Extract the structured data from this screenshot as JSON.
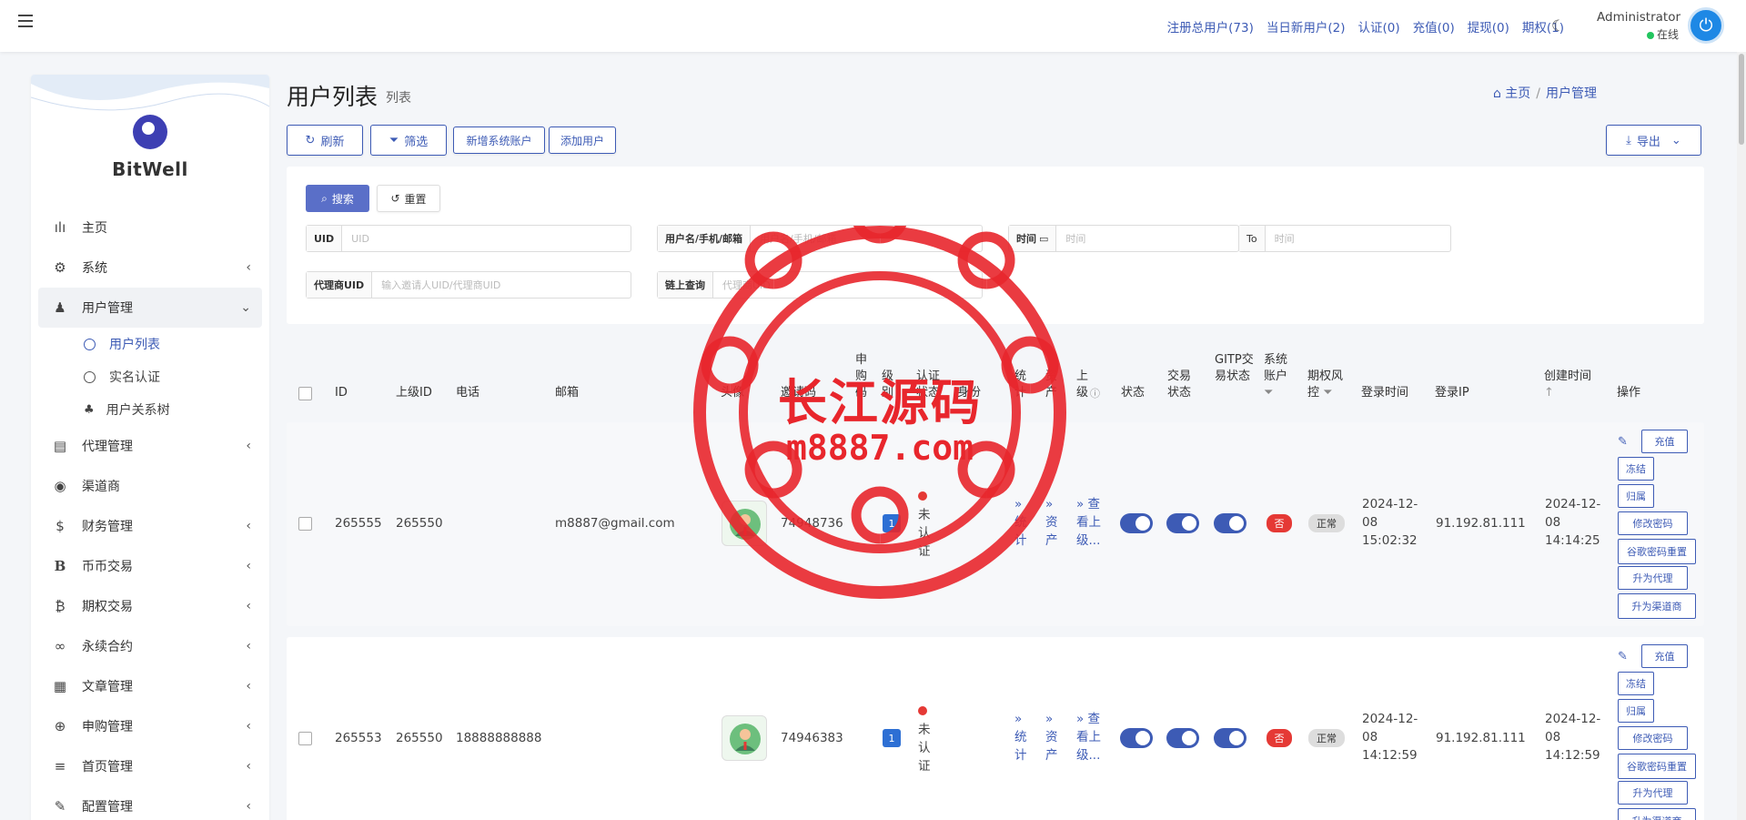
{
  "topbar": {
    "nav": [
      "注册总用户(73)",
      "当日新用户(2)",
      "认证(0)",
      "充值(0)",
      "提现(0)",
      "期权(1)"
    ],
    "admin_name": "Administrator",
    "admin_status": "在线"
  },
  "sidebar": {
    "logo": "BitWell",
    "items": [
      {
        "label": "主页",
        "icon": "bar-chart-icon",
        "glyph": "▮▮▮",
        "chevron": false
      },
      {
        "label": "系统",
        "icon": "gear-icon",
        "glyph": "⚙",
        "chevron": true
      },
      {
        "label": "用户管理",
        "icon": "users-icon",
        "glyph": "♟",
        "chevron": true,
        "open": true
      },
      {
        "label": "代理管理",
        "icon": "id-card-icon",
        "glyph": "▤",
        "chevron": true
      },
      {
        "label": "渠道商",
        "icon": "user-circle-icon",
        "glyph": "◉",
        "chevron": false
      },
      {
        "label": "财务管理",
        "icon": "dollar-icon",
        "glyph": "$",
        "chevron": true
      },
      {
        "label": "币币交易",
        "icon": "b-letter-icon",
        "glyph": "B",
        "chevron": true
      },
      {
        "label": "期权交易",
        "icon": "bitcoin-icon",
        "glyph": "₿",
        "chevron": true
      },
      {
        "label": "永续合约",
        "icon": "link-icon",
        "glyph": "∞",
        "chevron": true
      },
      {
        "label": "文章管理",
        "icon": "newspaper-icon",
        "glyph": "▦",
        "chevron": true
      },
      {
        "label": "申购管理",
        "icon": "lifebuoy-icon",
        "glyph": "⊕",
        "chevron": true
      },
      {
        "label": "首页管理",
        "icon": "list-icon",
        "glyph": "≡",
        "chevron": true
      },
      {
        "label": "配置管理",
        "icon": "wrench-icon",
        "glyph": "✎",
        "chevron": true
      }
    ],
    "sub_items": [
      "用户列表",
      "实名认证",
      "用户关系树"
    ]
  },
  "page": {
    "title": "用户列表",
    "subtitle": "列表",
    "crumb_home": "主页",
    "crumb_current": "用户管理"
  },
  "toolbar": {
    "refresh": "刷新",
    "filter": "筛选",
    "add_system": "新增系统账户",
    "add_user": "添加用户",
    "export": "导出"
  },
  "filters": {
    "search": "搜索",
    "reset": "重置",
    "uid_label": "UID",
    "uid_placeholder": "UID",
    "username_label": "用户名/手机/邮箱",
    "username_placeholder": "用户名/手机/邮箱",
    "time_label": "时间",
    "time_placeholder": "时间",
    "to_label": "To",
    "time2_placeholder": "时间",
    "agent_label": "代理商UID",
    "agent_placeholder": "输入邀请人UID/代理商UID",
    "chain_label": "链上查询",
    "chain_placeholder": "代理商UID"
  },
  "table": {
    "headers": {
      "id": "ID",
      "parent_id": "上级ID",
      "phone": "电话",
      "email": "邮箱",
      "avatar": "头像",
      "invite": "邀请码",
      "subscribe": "申购码",
      "level": "级别",
      "auth": "认证状态",
      "identity": "身份",
      "stats": "统计",
      "assets": "资产",
      "parent": "上级",
      "status": "状态",
      "trade_status": "交易状态",
      "gitp": "GITP交易状态",
      "system_account": "系统账户",
      "option_risk": "期权风控",
      "login_time": "登录时间",
      "login_ip": "登录IP",
      "created": "创建时间",
      "actions": "操作"
    },
    "rows": [
      {
        "id": "265555",
        "parent_id": "265550",
        "phone": "",
        "email": "m8887@gmail.com",
        "invite": "74948736",
        "level": "1",
        "auth": "未认证",
        "stats": "» 统计",
        "assets": "» 资产",
        "parent": "» 查看上级...",
        "system_account": "否",
        "option_risk": "正常",
        "login_time": "2024-12-08 15:02:32",
        "login_ip": "91.192.81.111",
        "created": "2024-12-08 14:14:25"
      },
      {
        "id": "265553",
        "parent_id": "265550",
        "phone": "18888888888",
        "email": "",
        "invite": "74946383",
        "level": "1",
        "auth": "未认证",
        "stats": "» 统计",
        "assets": "» 资产",
        "parent": "» 查看上级...",
        "system_account": "否",
        "option_risk": "正常",
        "login_time": "2024-12-08 14:12:59",
        "login_ip": "91.192.81.111",
        "created": "2024-12-08 14:12:59"
      }
    ],
    "actions": {
      "recharge": "充值",
      "freeze": "冻结",
      "assign": "归属",
      "change_password": "修改密码",
      "google_reset": "谷歌密码重置",
      "to_agent": "升为代理",
      "to_channel": "升为渠道商"
    }
  },
  "watermark": {
    "line1": "长江源码",
    "line2": "m8887.com"
  },
  "colors": {
    "accent": "#3d5bb5",
    "danger": "#e53935",
    "stamp": "#e8262c"
  }
}
